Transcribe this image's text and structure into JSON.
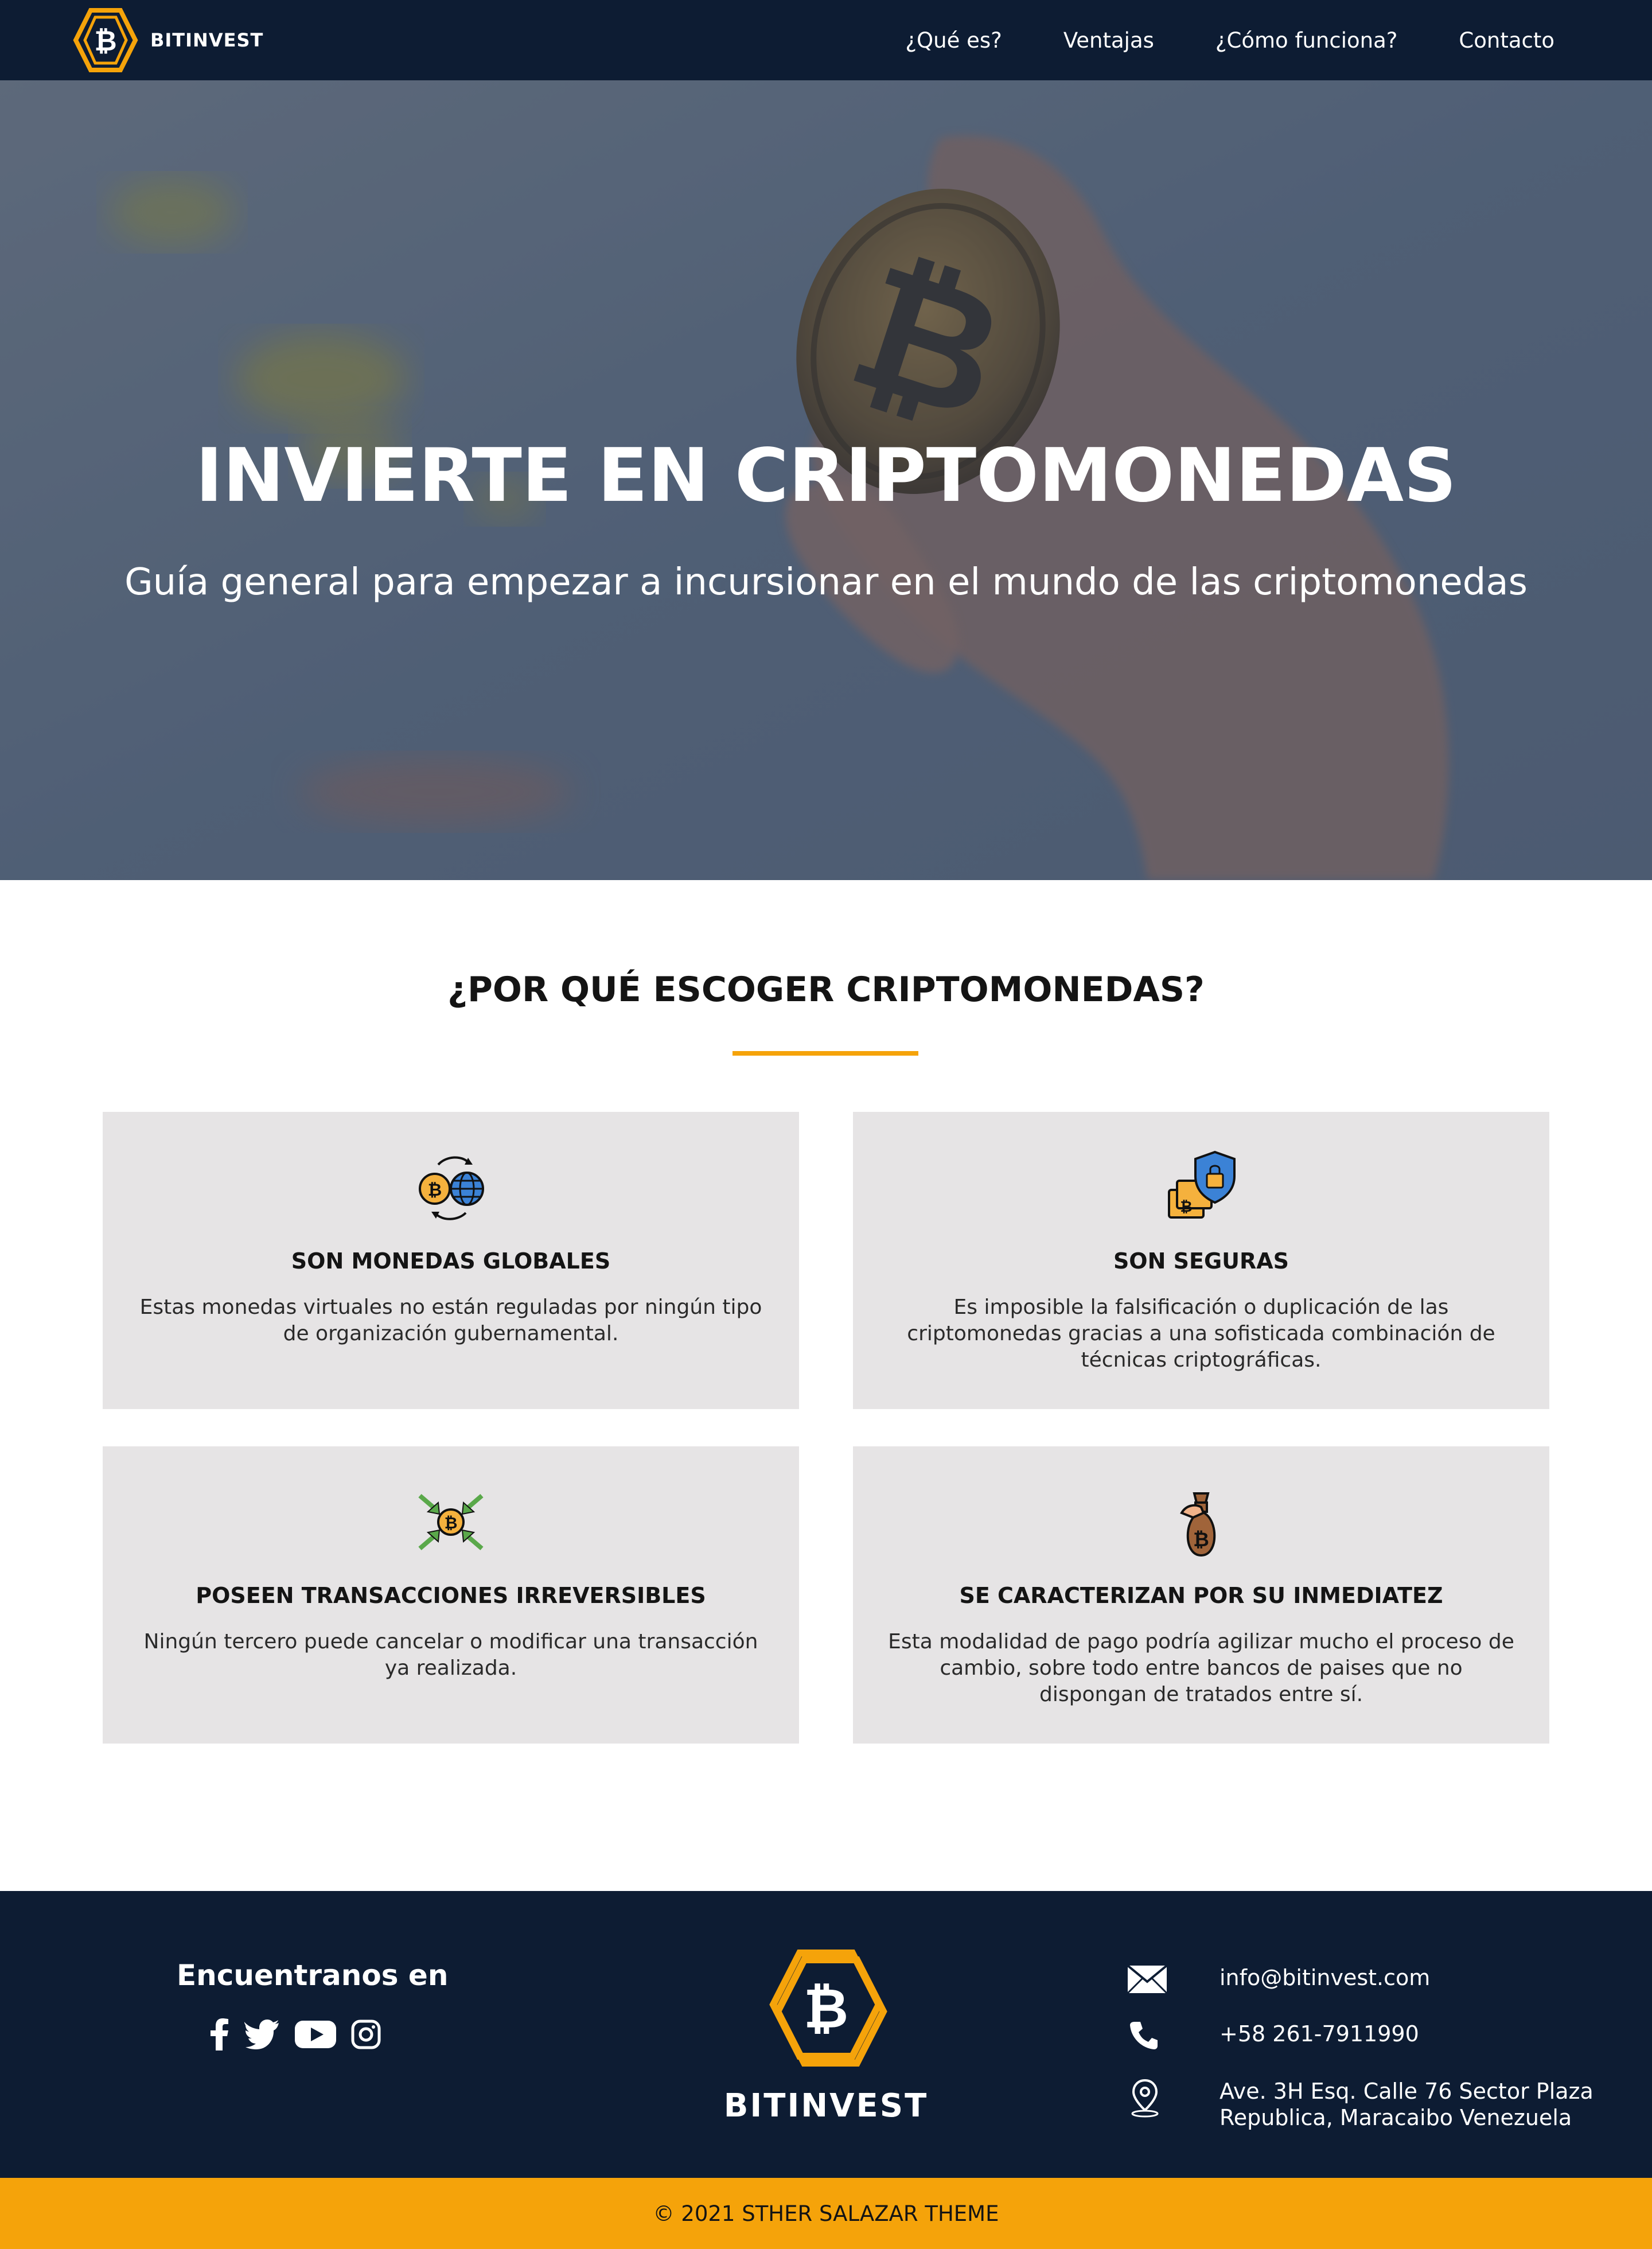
{
  "nav": {
    "brand": "BITINVEST",
    "links": [
      "¿Qué es?",
      "Ventajas",
      "¿Cómo funciona?",
      "Contacto"
    ]
  },
  "hero": {
    "title": "INVIERTE EN CRIPTOMONEDAS",
    "subtitle": "Guía general para empezar a incursionar en el mundo de las criptomonedas"
  },
  "features": {
    "title": "¿POR QUÉ ESCOGER CRIPTOMONEDAS?",
    "accent_color": "#f5a30a",
    "cards": [
      {
        "icon": "bitcoin-globe-exchange-icon",
        "title": "SON MONEDAS GLOBALES",
        "text": "Estas monedas virtuales no están reguladas por ningún tipo de organización gubernamental."
      },
      {
        "icon": "security-shield-wallet-icon",
        "title": "SON SEGURAS",
        "text": "Es imposible la falsificación o duplicación de las criptomonedas gracias a una sofisticada combinación de técnicas criptográficas."
      },
      {
        "icon": "transaction-arrows-icon",
        "title": "POSEEN TRANSACCIONES IRREVERSIBLES",
        "text": "Ningún tercero puede cancelar o modificar una transacción ya realizada."
      },
      {
        "icon": "money-bag-hand-icon",
        "title": "SE CARACTERIZAN POR SU INMEDIATEZ",
        "text": "Esta modalidad de pago podría agilizar mucho el proceso de cambio, sobre todo entre bancos de paises que no dispongan de tratados entre sí."
      }
    ]
  },
  "footer": {
    "find_title": "Encuentranos en",
    "socials": [
      "facebook-icon",
      "twitter-icon",
      "youtube-icon",
      "instagram-icon"
    ],
    "brand": "BITINVEST",
    "email": "info@bitinvest.com",
    "phone": "+58 261-7911990",
    "address_line1": "Ave. 3H Esq. Calle 76 Sector Plaza",
    "address_line2": "Republica, Maracaibo Venezuela",
    "copyright": "© 2021 STHER SALAZAR THEME"
  },
  "colors": {
    "navy": "#0d1c33",
    "orange": "#f5a30a",
    "card_bg": "#e6e4e5"
  }
}
